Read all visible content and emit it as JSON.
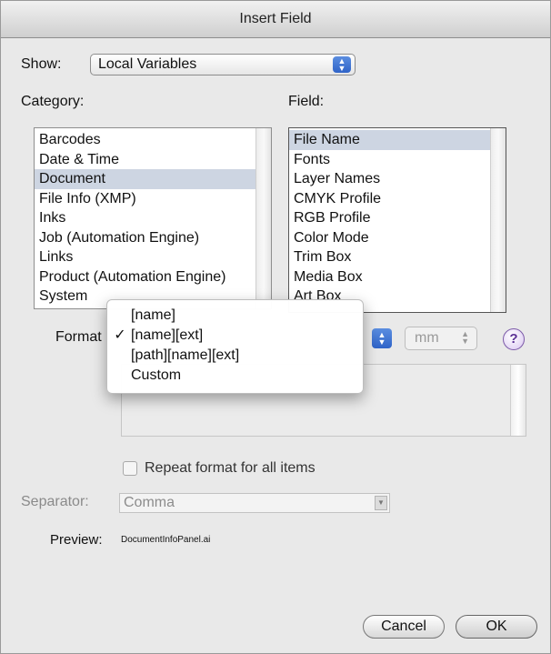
{
  "window": {
    "title": "Insert Field"
  },
  "show": {
    "label": "Show:",
    "value": "Local Variables"
  },
  "category": {
    "label": "Category:",
    "items": [
      "Barcodes",
      "Date & Time",
      "Document",
      "File Info (XMP)",
      "Inks",
      "Job (Automation Engine)",
      "Links",
      "Product (Automation Engine)",
      "System"
    ],
    "selected": "Document"
  },
  "field": {
    "label": "Field:",
    "items": [
      "File Name",
      "Fonts",
      "Layer Names",
      "CMYK Profile",
      "RGB Profile",
      "Color Mode",
      "Trim Box",
      "Media Box",
      "Art Box"
    ],
    "selected": "File Name"
  },
  "format": {
    "label": "Format",
    "menu": [
      {
        "text": "[name]",
        "checked": false
      },
      {
        "text": "[name][ext]",
        "checked": true
      },
      {
        "text": "[path][name][ext]",
        "checked": false
      },
      {
        "text": "Custom",
        "checked": false
      }
    ],
    "check_glyph": "✓"
  },
  "units": {
    "value": "mm"
  },
  "help": {
    "glyph": "?"
  },
  "repeat": {
    "label": "Repeat format for all items",
    "checked": false
  },
  "separator": {
    "label": "Separator:",
    "value": "Comma"
  },
  "preview": {
    "label": "Preview:",
    "value": "DocumentInfoPanel.ai"
  },
  "buttons": {
    "cancel": "Cancel",
    "ok": "OK"
  }
}
